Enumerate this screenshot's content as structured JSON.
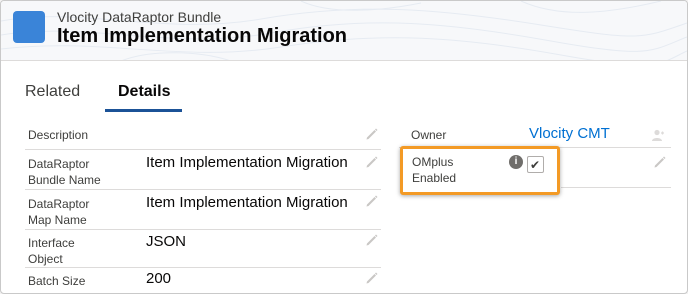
{
  "header": {
    "object_type": "Vlocity DataRaptor Bundle",
    "title": "Item Implementation Migration",
    "icon": "app-icon"
  },
  "tabs": [
    {
      "label": "Related",
      "active": false
    },
    {
      "label": "Details",
      "active": true
    }
  ],
  "left_fields": [
    {
      "label": "Description",
      "value": ""
    },
    {
      "label_line1": "DataRaptor",
      "label_line2": "Bundle Name",
      "value": "Item Implementation Migration"
    },
    {
      "label_line1": "DataRaptor",
      "label_line2": "Map Name",
      "value": "Item Implementation Migration"
    },
    {
      "label_line1": "Interface",
      "label_line2": "Object",
      "value": "JSON"
    },
    {
      "label": "Batch Size",
      "value": "200"
    }
  ],
  "right_fields": {
    "owner": {
      "label": "Owner",
      "value": "Vlocity CMT"
    },
    "omplus": {
      "label_line1": "OMplus",
      "label_line2": "Enabled",
      "checked": true,
      "info_glyph": "i",
      "check_glyph": "✔"
    }
  },
  "colors": {
    "highlight": "#f39a25",
    "link": "#0070d2",
    "tab_active": "#1b5297",
    "app_icon": "#3a84d8"
  }
}
